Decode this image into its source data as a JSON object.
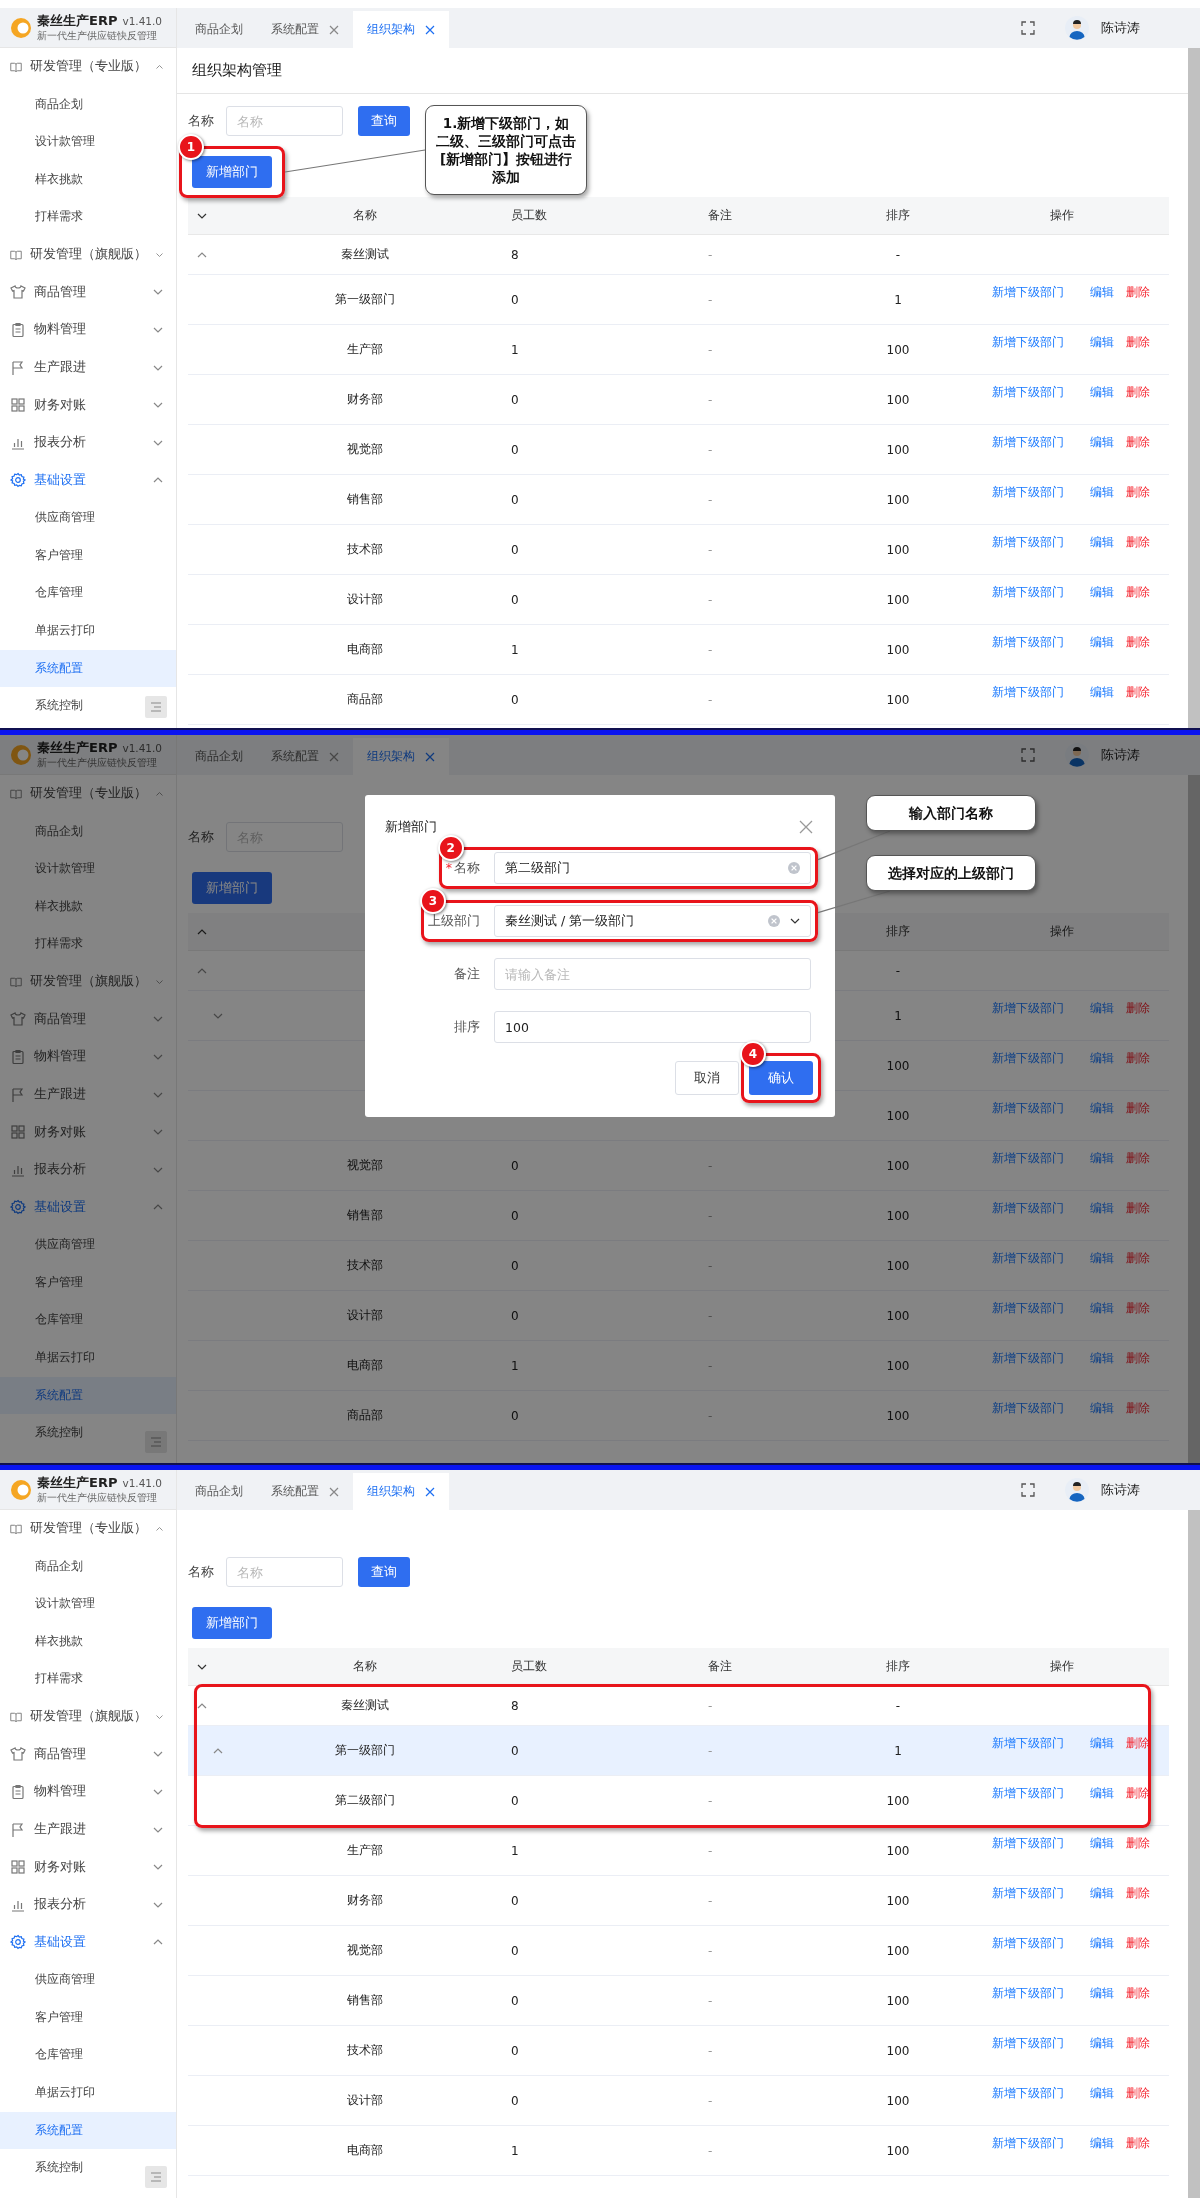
{
  "panels": [
    {
      "app": {
        "name": "秦丝生产ERP",
        "version": "v1.41.0",
        "tagline": "新一代生产供应链快反管理"
      },
      "tabs": [
        {
          "label": "商品企划",
          "closable": false,
          "selected": false
        },
        {
          "label": "系统配置",
          "closable": true,
          "selected": false
        },
        {
          "label": "组织架构",
          "closable": true,
          "selected": true
        }
      ],
      "user": {
        "name": "陈诗涛"
      },
      "sidebar": [
        {
          "label": "研发管理（专业版）",
          "expanded": true,
          "active": false,
          "children": [
            {
              "label": "商品企划",
              "selected": false
            },
            {
              "label": "设计款管理",
              "selected": false
            },
            {
              "label": "样衣挑款",
              "selected": false
            },
            {
              "label": "打样需求",
              "selected": false
            }
          ]
        },
        {
          "label": "研发管理（旗舰版）",
          "expanded": false,
          "active": false
        },
        {
          "label": "商品管理",
          "expanded": false,
          "active": false
        },
        {
          "label": "物料管理",
          "expanded": false,
          "active": false
        },
        {
          "label": "生产跟进",
          "expanded": false,
          "active": false
        },
        {
          "label": "财务对账",
          "expanded": false,
          "active": false
        },
        {
          "label": "报表分析",
          "expanded": false,
          "active": false
        },
        {
          "label": "基础设置",
          "expanded": true,
          "active": true,
          "children": [
            {
              "label": "供应商管理",
              "selected": false
            },
            {
              "label": "客户管理",
              "selected": false
            },
            {
              "label": "仓库管理",
              "selected": false
            },
            {
              "label": "单据云打印",
              "selected": false
            },
            {
              "label": "系统配置",
              "selected": true
            },
            {
              "label": "系统控制",
              "selected": false
            }
          ]
        }
      ],
      "page_title": "组织架构管理",
      "search": {
        "label": "名称",
        "placeholder": "名称",
        "button": "查询"
      },
      "add_button": {
        "label": "新增部门",
        "badge": "1",
        "callout": "1.新增下级部门，如二级、三级部门可点击[新增部门】按钮进行添加"
      },
      "table": {
        "expanded": false,
        "columns": [
          {
            "label": "名称"
          },
          {
            "label": "员工数"
          },
          {
            "label": "备注"
          },
          {
            "label": "排序"
          },
          {
            "label": "操作"
          }
        ],
        "rows": [
          {
            "name": "秦丝测试",
            "count": "8",
            "note": "-",
            "sort": "-",
            "expanded": true,
            "children": [
              {
                "name": "第一级部门",
                "count": "0",
                "note": "-",
                "sort": "1",
                "actions": [
                  {
                    "label": "新增下级部门",
                    "kind": "add"
                  },
                  {
                    "label": "编辑",
                    "kind": "edit"
                  },
                  {
                    "label": "删除",
                    "kind": "delete"
                  }
                ]
              },
              {
                "name": "生产部",
                "count": "1",
                "note": "-",
                "sort": "100",
                "actions": [
                  {
                    "label": "新增下级部门",
                    "kind": "add"
                  },
                  {
                    "label": "编辑",
                    "kind": "edit"
                  },
                  {
                    "label": "删除",
                    "kind": "delete"
                  }
                ]
              },
              {
                "name": "财务部",
                "count": "0",
                "note": "-",
                "sort": "100",
                "actions": [
                  {
                    "label": "新增下级部门",
                    "kind": "add"
                  },
                  {
                    "label": "编辑",
                    "kind": "edit"
                  },
                  {
                    "label": "删除",
                    "kind": "delete"
                  }
                ]
              },
              {
                "name": "视觉部",
                "count": "0",
                "note": "-",
                "sort": "100",
                "actions": [
                  {
                    "label": "新增下级部门",
                    "kind": "add"
                  },
                  {
                    "label": "编辑",
                    "kind": "edit"
                  },
                  {
                    "label": "删除",
                    "kind": "delete"
                  }
                ]
              },
              {
                "name": "销售部",
                "count": "0",
                "note": "-",
                "sort": "100",
                "actions": [
                  {
                    "label": "新增下级部门",
                    "kind": "add"
                  },
                  {
                    "label": "编辑",
                    "kind": "edit"
                  },
                  {
                    "label": "删除",
                    "kind": "delete"
                  }
                ]
              },
              {
                "name": "技术部",
                "count": "0",
                "note": "-",
                "sort": "100",
                "actions": [
                  {
                    "label": "新增下级部门",
                    "kind": "add"
                  },
                  {
                    "label": "编辑",
                    "kind": "edit"
                  },
                  {
                    "label": "删除",
                    "kind": "delete"
                  }
                ]
              },
              {
                "name": "设计部",
                "count": "0",
                "note": "-",
                "sort": "100",
                "actions": [
                  {
                    "label": "新增下级部门",
                    "kind": "add"
                  },
                  {
                    "label": "编辑",
                    "kind": "edit"
                  },
                  {
                    "label": "删除",
                    "kind": "delete"
                  }
                ]
              },
              {
                "name": "电商部",
                "count": "1",
                "note": "-",
                "sort": "100",
                "actions": [
                  {
                    "label": "新增下级部门",
                    "kind": "add"
                  },
                  {
                    "label": "编辑",
                    "kind": "edit"
                  },
                  {
                    "label": "删除",
                    "kind": "delete"
                  }
                ]
              },
              {
                "name": "商品部",
                "count": "0",
                "note": "-",
                "sort": "100",
                "actions": [
                  {
                    "label": "新增下级部门",
                    "kind": "add"
                  },
                  {
                    "label": "编辑",
                    "kind": "edit"
                  },
                  {
                    "label": "删除",
                    "kind": "delete"
                  }
                ]
              }
            ]
          }
        ]
      }
    },
    {
      "app": {
        "name": "秦丝生产ERP",
        "version": "v1.41.0",
        "tagline": "新一代生产供应链快反管理"
      },
      "tabs": [
        {
          "label": "商品企划",
          "closable": false,
          "selected": false
        },
        {
          "label": "系统配置",
          "closable": true,
          "selected": false
        },
        {
          "label": "组织架构",
          "closable": true,
          "selected": true
        }
      ],
      "user": {
        "name": "陈诗涛"
      },
      "sidebar": [
        {
          "label": "研发管理（专业版）",
          "expanded": true,
          "active": false,
          "children": [
            {
              "label": "商品企划",
              "selected": false
            },
            {
              "label": "设计款管理",
              "selected": false
            },
            {
              "label": "样衣挑款",
              "selected": false
            },
            {
              "label": "打样需求",
              "selected": false
            }
          ]
        },
        {
          "label": "研发管理（旗舰版）",
          "expanded": false,
          "active": false
        },
        {
          "label": "商品管理",
          "expanded": false,
          "active": false
        },
        {
          "label": "物料管理",
          "expanded": false,
          "active": false
        },
        {
          "label": "生产跟进",
          "expanded": false,
          "active": false
        },
        {
          "label": "财务对账",
          "expanded": false,
          "active": false
        },
        {
          "label": "报表分析",
          "expanded": false,
          "active": false
        },
        {
          "label": "基础设置",
          "expanded": true,
          "active": true,
          "children": [
            {
              "label": "供应商管理",
              "selected": false
            },
            {
              "label": "客户管理",
              "selected": false
            },
            {
              "label": "仓库管理",
              "selected": false
            },
            {
              "label": "单据云打印",
              "selected": false
            },
            {
              "label": "系统配置",
              "selected": true
            },
            {
              "label": "系统控制",
              "selected": false
            }
          ]
        }
      ],
      "search": {
        "label": "名称",
        "placeholder": "名称"
      },
      "add_button": {
        "label": "新增部门"
      },
      "table": {
        "expanded": true,
        "columns": [
          {},
          {},
          {},
          {
            "label": "排序"
          },
          {
            "label": "操作"
          }
        ],
        "rows": [
          {
            "sort": "-",
            "expanded": true,
            "children": [
              {
                "sort": "1",
                "expanded": false,
                "actions": [
                  {
                    "label": "新增下级部门",
                    "kind": "add"
                  },
                  {
                    "label": "编辑",
                    "kind": "edit"
                  },
                  {
                    "label": "删除",
                    "kind": "delete"
                  }
                ]
              },
              {
                "sort": "100",
                "actions": [
                  {
                    "label": "新增下级部门",
                    "kind": "add"
                  },
                  {
                    "label": "编辑",
                    "kind": "edit"
                  },
                  {
                    "label": "删除",
                    "kind": "delete"
                  }
                ]
              },
              {
                "sort": "100",
                "actions": [
                  {
                    "label": "新增下级部门",
                    "kind": "add"
                  },
                  {
                    "label": "编辑",
                    "kind": "edit"
                  },
                  {
                    "label": "删除",
                    "kind": "delete"
                  }
                ]
              },
              {
                "name": "视觉部",
                "count": "0",
                "note": "-",
                "sort": "100",
                "actions": [
                  {
                    "label": "新增下级部门",
                    "kind": "add"
                  },
                  {
                    "label": "编辑",
                    "kind": "edit"
                  },
                  {
                    "label": "删除",
                    "kind": "delete"
                  }
                ]
              },
              {
                "name": "销售部",
                "count": "0",
                "note": "-",
                "sort": "100",
                "actions": [
                  {
                    "label": "新增下级部门",
                    "kind": "add"
                  },
                  {
                    "label": "编辑",
                    "kind": "edit"
                  },
                  {
                    "label": "删除",
                    "kind": "delete"
                  }
                ]
              },
              {
                "name": "技术部",
                "count": "0",
                "note": "-",
                "sort": "100",
                "actions": [
                  {
                    "label": "新增下级部门",
                    "kind": "add"
                  },
                  {
                    "label": "编辑",
                    "kind": "edit"
                  },
                  {
                    "label": "删除",
                    "kind": "delete"
                  }
                ]
              },
              {
                "name": "设计部",
                "count": "0",
                "note": "-",
                "sort": "100",
                "actions": [
                  {
                    "label": "新增下级部门",
                    "kind": "add"
                  },
                  {
                    "label": "编辑",
                    "kind": "edit"
                  },
                  {
                    "label": "删除",
                    "kind": "delete"
                  }
                ]
              },
              {
                "name": "电商部",
                "count": "1",
                "note": "-",
                "sort": "100",
                "actions": [
                  {
                    "label": "新增下级部门",
                    "kind": "add"
                  },
                  {
                    "label": "编辑",
                    "kind": "edit"
                  },
                  {
                    "label": "删除",
                    "kind": "delete"
                  }
                ]
              },
              {
                "name": "商品部",
                "count": "0",
                "note": "-",
                "sort": "100",
                "actions": [
                  {
                    "label": "新增下级部门",
                    "kind": "add"
                  },
                  {
                    "label": "编辑",
                    "kind": "edit"
                  },
                  {
                    "label": "删除",
                    "kind": "delete"
                  }
                ]
              }
            ]
          }
        ]
      },
      "dialog": {
        "title": "新增部门",
        "fields": [
          {
            "label": "名称",
            "required_mark": "*",
            "kind": "input",
            "value": "第二级部门",
            "clearable": true,
            "badge": "2",
            "callout": "输入部门名称"
          },
          {
            "label": "上级部门",
            "kind": "select",
            "value": "秦丝测试 / 第一级部门",
            "clearable": true,
            "badge": "3",
            "callout": "选择对应的上级部门"
          },
          {
            "label": "备注",
            "kind": "input",
            "placeholder": "请输入备注"
          },
          {
            "label": "排序",
            "kind": "input",
            "value": "100"
          }
        ],
        "buttons": [
          {
            "label": "取消",
            "kind": "default"
          },
          {
            "label": "确认",
            "kind": "primary",
            "badge": "4"
          }
        ]
      }
    },
    {
      "app": {
        "name": "秦丝生产ERP",
        "version": "v1.41.0",
        "tagline": "新一代生产供应链快反管理"
      },
      "tabs": [
        {
          "label": "商品企划",
          "closable": false,
          "selected": false
        },
        {
          "label": "系统配置",
          "closable": true,
          "selected": false
        },
        {
          "label": "组织架构",
          "closable": true,
          "selected": true
        }
      ],
      "user": {
        "name": "陈诗涛"
      },
      "sidebar": [
        {
          "label": "研发管理（专业版）",
          "expanded": true,
          "active": false,
          "children": [
            {
              "label": "商品企划",
              "selected": false
            },
            {
              "label": "设计款管理",
              "selected": false
            },
            {
              "label": "样衣挑款",
              "selected": false
            },
            {
              "label": "打样需求",
              "selected": false
            }
          ]
        },
        {
          "label": "研发管理（旗舰版）",
          "expanded": false,
          "active": false
        },
        {
          "label": "商品管理",
          "expanded": false,
          "active": false
        },
        {
          "label": "物料管理",
          "expanded": false,
          "active": false
        },
        {
          "label": "生产跟进",
          "expanded": false,
          "active": false
        },
        {
          "label": "财务对账",
          "expanded": false,
          "active": false
        },
        {
          "label": "报表分析",
          "expanded": false,
          "active": false
        },
        {
          "label": "基础设置",
          "expanded": true,
          "active": true,
          "children": [
            {
              "label": "供应商管理",
              "selected": false
            },
            {
              "label": "客户管理",
              "selected": false
            },
            {
              "label": "仓库管理",
              "selected": false
            },
            {
              "label": "单据云打印",
              "selected": false
            },
            {
              "label": "系统配置",
              "selected": true
            },
            {
              "label": "系统控制",
              "selected": false
            }
          ]
        }
      ],
      "search": {
        "label": "名称",
        "placeholder": "名称",
        "button": "查询"
      },
      "add_button": {
        "label": "新增部门"
      },
      "table": {
        "expanded": false,
        "columns": [
          {
            "label": "名称"
          },
          {
            "label": "员工数"
          },
          {
            "label": "备注"
          },
          {
            "label": "排序"
          },
          {
            "label": "操作"
          }
        ],
        "rows": [
          {
            "name": "秦丝测试",
            "count": "8",
            "note": "-",
            "sort": "-",
            "expanded": true,
            "selected": false,
            "framed": true,
            "children": [
              {
                "name": "第一级部门",
                "count": "0",
                "note": "-",
                "sort": "1",
                "expanded": true,
                "selected": true,
                "framed": true,
                "actions": [
                  {
                    "label": "新增下级部门",
                    "kind": "add"
                  },
                  {
                    "label": "编辑",
                    "kind": "edit"
                  },
                  {
                    "label": "删除",
                    "kind": "delete"
                  }
                ],
                "children": [
                  {
                    "name": "第二级部门",
                    "count": "0",
                    "note": "-",
                    "sort": "100",
                    "selected": false,
                    "framed": true,
                    "actions": [
                      {
                        "label": "新增下级部门",
                        "kind": "add"
                      },
                      {
                        "label": "编辑",
                        "kind": "edit"
                      },
                      {
                        "label": "删除",
                        "kind": "delete"
                      }
                    ]
                  }
                ]
              },
              {
                "name": "生产部",
                "count": "1",
                "note": "-",
                "sort": "100",
                "selected": false,
                "framed": false,
                "actions": [
                  {
                    "label": "新增下级部门",
                    "kind": "add"
                  },
                  {
                    "label": "编辑",
                    "kind": "edit"
                  },
                  {
                    "label": "删除",
                    "kind": "delete"
                  }
                ]
              },
              {
                "name": "财务部",
                "count": "0",
                "note": "-",
                "sort": "100",
                "selected": false,
                "framed": false,
                "actions": [
                  {
                    "label": "新增下级部门",
                    "kind": "add"
                  },
                  {
                    "label": "编辑",
                    "kind": "edit"
                  },
                  {
                    "label": "删除",
                    "kind": "delete"
                  }
                ]
              },
              {
                "name": "视觉部",
                "count": "0",
                "note": "-",
                "sort": "100",
                "selected": false,
                "framed": false,
                "actions": [
                  {
                    "label": "新增下级部门",
                    "kind": "add"
                  },
                  {
                    "label": "编辑",
                    "kind": "edit"
                  },
                  {
                    "label": "删除",
                    "kind": "delete"
                  }
                ]
              },
              {
                "name": "销售部",
                "count": "0",
                "note": "-",
                "sort": "100",
                "selected": false,
                "framed": false,
                "actions": [
                  {
                    "label": "新增下级部门",
                    "kind": "add"
                  },
                  {
                    "label": "编辑",
                    "kind": "edit"
                  },
                  {
                    "label": "删除",
                    "kind": "delete"
                  }
                ]
              },
              {
                "name": "技术部",
                "count": "0",
                "note": "-",
                "sort": "100",
                "selected": false,
                "framed": false,
                "actions": [
                  {
                    "label": "新增下级部门",
                    "kind": "add"
                  },
                  {
                    "label": "编辑",
                    "kind": "edit"
                  },
                  {
                    "label": "删除",
                    "kind": "delete"
                  }
                ]
              },
              {
                "name": "设计部",
                "count": "0",
                "note": "-",
                "sort": "100",
                "selected": false,
                "framed": false,
                "actions": [
                  {
                    "label": "新增下级部门",
                    "kind": "add"
                  },
                  {
                    "label": "编辑",
                    "kind": "edit"
                  },
                  {
                    "label": "删除",
                    "kind": "delete"
                  }
                ]
              },
              {
                "name": "电商部",
                "count": "1",
                "note": "-",
                "sort": "100",
                "selected": false,
                "framed": false,
                "actions": [
                  {
                    "label": "新增下级部门",
                    "kind": "add"
                  },
                  {
                    "label": "编辑",
                    "kind": "edit"
                  },
                  {
                    "label": "删除",
                    "kind": "delete"
                  }
                ]
              }
            ]
          }
        ]
      }
    }
  ]
}
